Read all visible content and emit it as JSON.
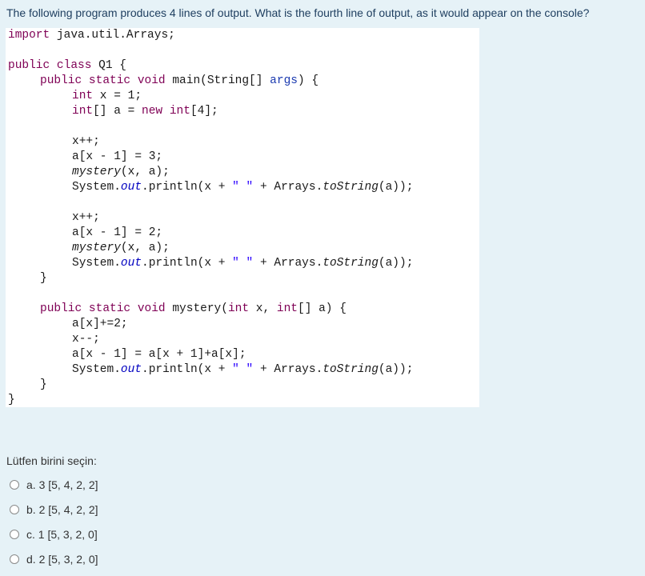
{
  "question": {
    "text": "The following program produces 4 lines of output.  What is the fourth line of output, as it would appear on the console?"
  },
  "code": {
    "line_import_kw": "import",
    "line_import_rest": " java.util.Arrays;",
    "line_class_kw": "public class",
    "line_class_rest": " Q1 {",
    "line_main_kw1": "public static void",
    "line_main_mid": " main(String[] ",
    "line_main_args": "args",
    "line_main_end": ") {",
    "line_intx_kw": "int",
    "line_intx_rest": " x = 1;",
    "line_arr_kw": "int",
    "line_arr_mid": "[] a = ",
    "line_arr_new": "new",
    "line_arr_int": " int",
    "line_arr_end": "[4];",
    "line_inc1": "x++;",
    "line_assign1": "a[x - 1] = 3;",
    "line_mystery1": "mystery",
    "line_mystery1_rest": "(x, a);",
    "line_print_start": "System.",
    "line_print_out": "out",
    "line_print_mid": ".println(x + ",
    "line_print_str": "\" \"",
    "line_print_plus": " + Arrays.",
    "line_print_tostring": "toString",
    "line_print_end": "(a));",
    "line_inc2": "x++;",
    "line_assign2": "a[x - 1] = 2;",
    "line_close_main": "}",
    "line_myst_kw": "public static void",
    "line_myst_mid": " mystery(",
    "line_myst_int": "int",
    "line_myst_x": " x, ",
    "line_myst_int2": "int",
    "line_myst_end": "[] a) {",
    "line_ax": "a[x]+=2;",
    "line_dec": "x--;",
    "line_ax2": "a[x - 1] = a[x + 1]+a[x];",
    "line_close_myst": "}",
    "line_close_class": "}"
  },
  "prompt": "Lütfen birini seçin:",
  "options": [
    {
      "label": "a. 3 [5, 4, 2, 2]"
    },
    {
      "label": "b. 2 [5, 4, 2, 2]"
    },
    {
      "label": "c. 1 [5, 3, 2, 0]"
    },
    {
      "label": "d. 2 [5, 3, 2, 0]"
    }
  ]
}
